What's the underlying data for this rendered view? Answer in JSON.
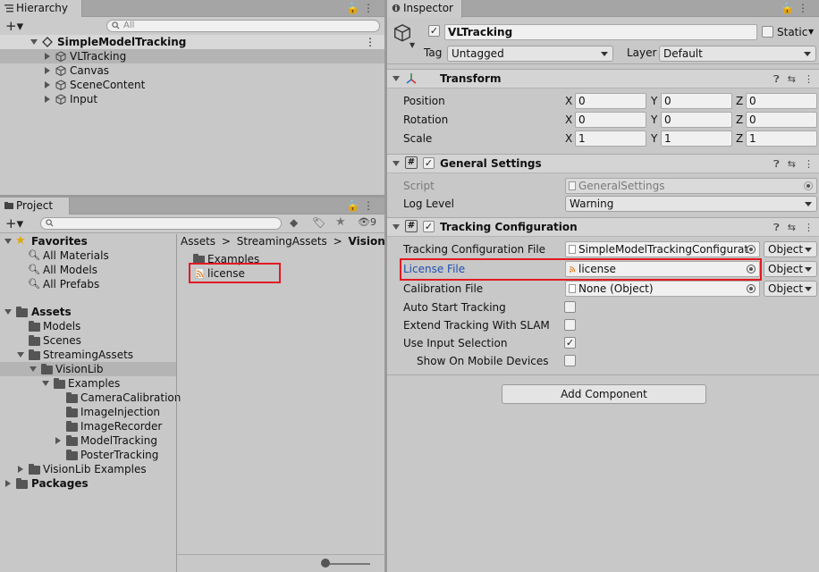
{
  "hierarchy": {
    "tab_label": "Hierarchy",
    "search_placeholder": "All",
    "scene_name": "SimpleModelTracking",
    "items": [
      "VLTracking",
      "Canvas",
      "SceneContent",
      "Input"
    ]
  },
  "project": {
    "tab_label": "Project",
    "hidden_count": "9",
    "favorites": {
      "label": "Favorites",
      "items": [
        "All Materials",
        "All Models",
        "All Prefabs"
      ]
    },
    "assets": {
      "label": "Assets",
      "items": [
        "Models",
        "Scenes",
        "StreamingAssets",
        "VisionLib",
        "Examples",
        "CameraCalibration",
        "ImageInjection",
        "ImageRecorder",
        "ModelTracking",
        "PosterTracking",
        "VisionLib Examples"
      ]
    },
    "packages_label": "Packages",
    "breadcrumb": [
      "Assets",
      "StreamingAssets",
      "VisionLib"
    ],
    "breadcrumb_sep": ">",
    "files": [
      "Examples",
      "license"
    ]
  },
  "inspector": {
    "tab_label": "Inspector",
    "object_name": "VLTracking",
    "static_label": "Static",
    "tag_label": "Tag",
    "tag_value": "Untagged",
    "layer_label": "Layer",
    "layer_value": "Default",
    "transform": {
      "title": "Transform",
      "rows": [
        {
          "label": "Position",
          "x": "0",
          "y": "0",
          "z": "0"
        },
        {
          "label": "Rotation",
          "x": "0",
          "y": "0",
          "z": "0"
        },
        {
          "label": "Scale",
          "x": "1",
          "y": "1",
          "z": "1"
        }
      ],
      "axis_x": "X",
      "axis_y": "Y",
      "axis_z": "Z"
    },
    "general": {
      "title": "General Settings",
      "script_label": "Script",
      "script_value": "GeneralSettings",
      "log_label": "Log Level",
      "log_value": "Warning"
    },
    "tracking": {
      "title": "Tracking Configuration",
      "config_label": "Tracking Configuration File",
      "config_value": "SimpleModelTrackingConfigurat",
      "license_label": "License File",
      "license_value": "license",
      "calib_label": "Calibration File",
      "calib_value": "None (Object)",
      "object_dd": "Object",
      "auto_start_label": "Auto Start Tracking",
      "slam_label": "Extend Tracking With SLAM",
      "input_sel_label": "Use Input Selection",
      "mobile_label": "Show On Mobile Devices"
    },
    "add_component": "Add Component"
  },
  "colors": {
    "selection_red": "#e21a22",
    "link_blue": "#1f4fb0",
    "panel_bg": "#c8c8c8"
  }
}
